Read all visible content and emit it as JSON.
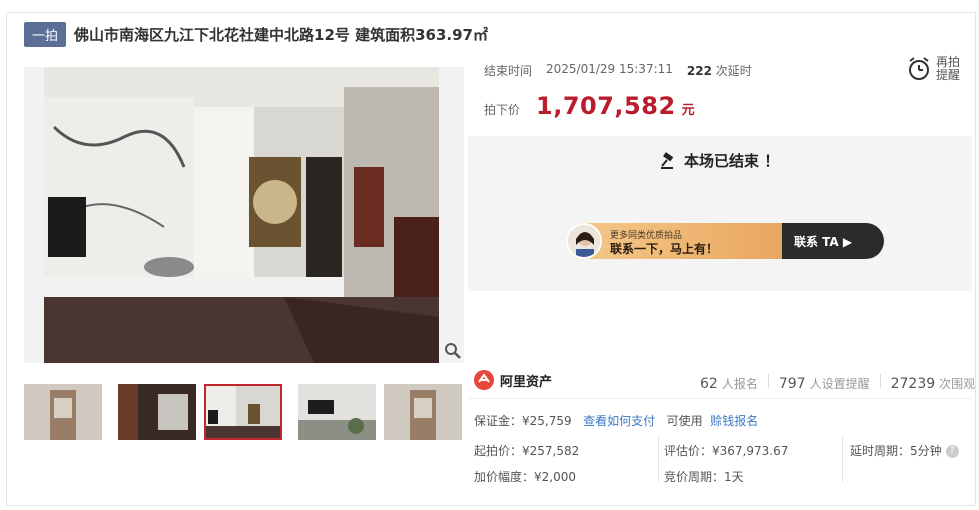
{
  "header": {
    "tag": "一拍",
    "title": "佛山市南海区九江下北花社建中北路12号 建筑面积363.97㎡"
  },
  "auction": {
    "end_label": "结束时间",
    "end_time": "2025/01/29 15:37:11",
    "delay_count": "222",
    "delay_suffix": "次延时",
    "price_label": "拍下价",
    "price": "1,707,582",
    "price_unit": "元",
    "remind_label": "再拍提醒",
    "status_text": "本场已结束 ！"
  },
  "banner": {
    "line1": "更多同类优质拍品",
    "line2": "联系一下，马上有！",
    "cta": "联系 TA"
  },
  "platform": {
    "name": "阿里资产"
  },
  "stats": [
    {
      "num": "62",
      "label": "人报名"
    },
    {
      "num": "797",
      "label": "人设置提醒"
    },
    {
      "num": "27239",
      "label": "次围观"
    }
  ],
  "details": {
    "deposit_label": "保证金：",
    "deposit": "¥25,759",
    "how_pay": "查看如何支付",
    "can_use": "可使用",
    "credit_signup": "赊钱报名",
    "start_price": "起拍价：¥257,582",
    "appraisal": "评估价：¥367,973.67",
    "delay_period": "延时周期：5分钟",
    "increment": "加价幅度：¥2,000",
    "bid_period": "竞价周期：1天"
  },
  "colors": {
    "accent": "#b91c2c",
    "tag_bg": "#5a6e96",
    "link": "#3b78c4"
  }
}
